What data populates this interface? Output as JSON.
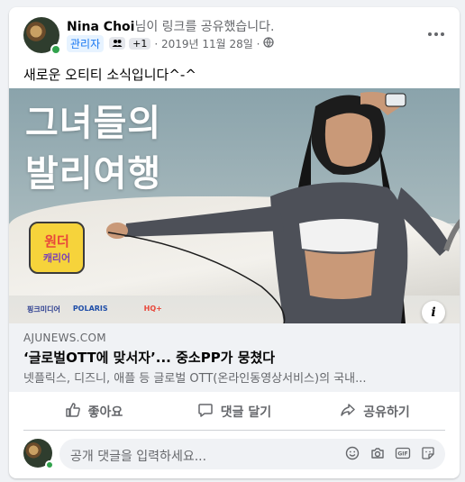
{
  "post": {
    "author": "Nina Choi",
    "action_text": "님이 링크를 공유했습니다.",
    "role_badge": "관리자",
    "plus_count": "+1",
    "date": "· 2019년 11월 28일 ·",
    "text": "새로운 오티티 소식입니다^-^"
  },
  "link": {
    "image_title_line1": "그녀들의",
    "image_title_line2": "발리여행",
    "logo_line1": "원더",
    "logo_line2": "캐리어",
    "sponsor1": "핑크미디어",
    "sponsor2": "POLARIS",
    "sponsor3": "HQ+",
    "info_label": "i",
    "domain": "AJUNEWS.COM",
    "title": "‘글로벌OTT에 맞서자’... 중소PP가 뭉쳤다",
    "description": "넷플릭스, 디즈니, 애플 등 글로벌 OTT(온라인동영상서비스)의 국내..."
  },
  "actions": {
    "like": "좋아요",
    "comment": "댓글 달기",
    "share": "공유하기"
  },
  "comment": {
    "placeholder": "공개 댓글을 입력하세요..."
  },
  "icons": {
    "like": "thumbs-up-icon",
    "comment": "speech-bubble-icon",
    "share": "share-arrow-icon",
    "globe": "globe-icon",
    "more": "more-dots-icon"
  },
  "colors": {
    "accent": "#1877f2",
    "online": "#31a24c",
    "muted_text": "#65676b"
  }
}
